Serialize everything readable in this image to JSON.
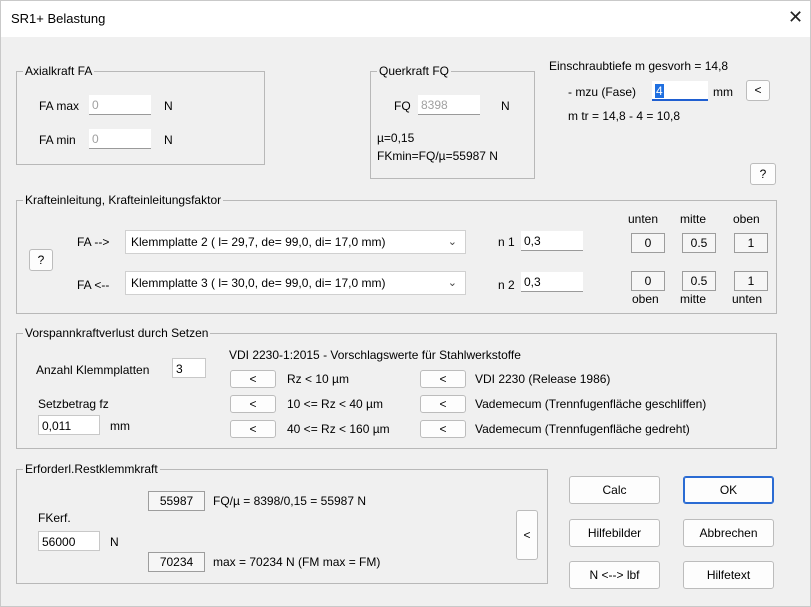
{
  "window": {
    "title": "SR1+ Belastung",
    "close_glyph": "✕"
  },
  "axialkraft": {
    "legend": "Axialkraft FA",
    "fa_max_label": "FA max",
    "fa_max_value": "0",
    "fa_max_unit": "N",
    "fa_min_label": "FA min",
    "fa_min_value": "0",
    "fa_min_unit": "N"
  },
  "querkraft": {
    "legend": "Querkraft FQ",
    "fq_label": "FQ",
    "fq_value": "8398",
    "fq_unit": "N",
    "mu_text": "µ=0,15",
    "fkmin_text": "FKmin=FQ/µ=55987 N"
  },
  "einschraub": {
    "title": "Einschraubtiefe m gesvorh = 14,8",
    "mzu_label": "- mzu (Fase)",
    "mzu_value": "4",
    "mzu_unit": "mm",
    "mzu_button": "<",
    "mtr_text": "m tr = 14,8 - 4 = 10,8",
    "help_button": "?"
  },
  "krafteinleitung": {
    "legend": "Krafteinleitung, Krafteinleitungsfaktor",
    "help_button": "?",
    "col_headers_top": [
      "unten",
      "mitte",
      "oben"
    ],
    "col_headers_bottom": [
      "oben",
      "mitte",
      "unten"
    ],
    "row1": {
      "label": "FA -->",
      "combo": "Klemmplatte 2  ( l= 29,7, de= 99,0, di= 17,0 mm)",
      "n_label": "n 1",
      "n_value": "0,3",
      "buttons": [
        "0",
        "0.5",
        "1"
      ]
    },
    "row2": {
      "label": "FA <--",
      "combo": "Klemmplatte 3  ( l= 30,0, de= 99,0, di= 17,0 mm)",
      "n_label": "n 2",
      "n_value": "0,3",
      "buttons": [
        "0",
        "0.5",
        "1"
      ]
    }
  },
  "vorspann": {
    "legend": "Vorspannkraftverlust durch Setzen",
    "anzahl_label": "Anzahl Klemmplatten",
    "anzahl_value": "3",
    "vdi_title": "VDI 2230-1:2015 - Vorschlagswerte für Stahlwerkstoffe",
    "setzbetrag_label": "Setzbetrag fz",
    "setzbetrag_value": "0,011",
    "setzbetrag_unit": "mm",
    "rz_rows": [
      {
        "button": "<",
        "text": "Rz < 10 µm"
      },
      {
        "button": "<",
        "text": "10 <= Rz < 40 µm"
      },
      {
        "button": "<",
        "text": "40 <= Rz < 160 µm"
      }
    ],
    "src_rows": [
      {
        "button": "<",
        "text": "VDI 2230 (Release 1986)"
      },
      {
        "button": "<",
        "text": "Vademecum (Trennfugenfläche geschliffen)"
      },
      {
        "button": "<",
        "text": "Vademecum (Trennfugenfläche gedreht)"
      }
    ]
  },
  "restklemm": {
    "legend": "Erforderl.Restklemmkraft",
    "fkerf_label": "FKerf.",
    "fkerf_value": "56000",
    "fkerf_unit": "N",
    "val1_box": "55987",
    "val1_text": "FQ/µ = 8398/0,15 = 55987 N",
    "val2_box": "70234",
    "val2_text": "max = 70234 N  (FM max = FM)",
    "side_button": "<"
  },
  "actions": {
    "calc": "Calc",
    "ok": "OK",
    "hilfebilder": "Hilfebilder",
    "abbrechen": "Abbrechen",
    "nlbf": "N <--> lbf",
    "hilfetext": "Hilfetext"
  }
}
